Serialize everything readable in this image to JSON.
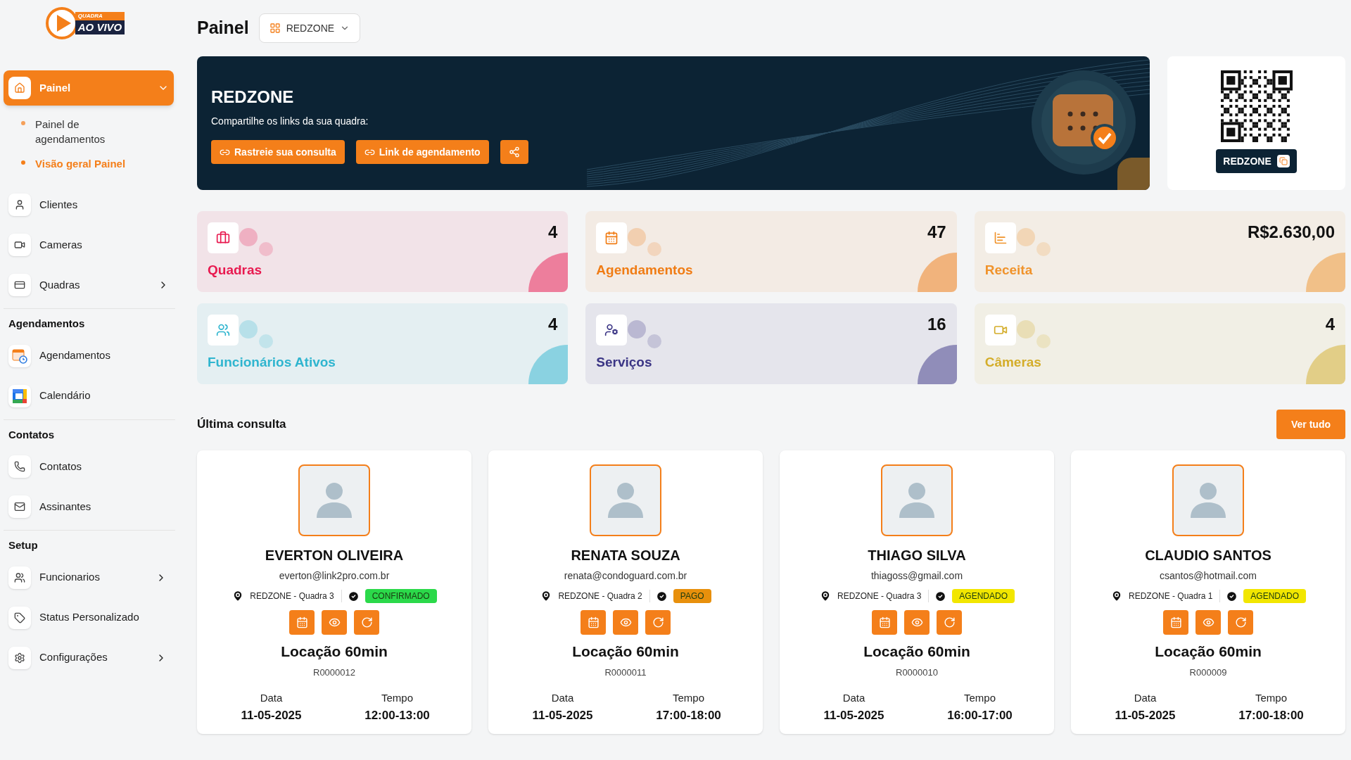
{
  "logo": {
    "top": "QUADRA",
    "bottom": "AO VIVO"
  },
  "sidebar": {
    "nav": [
      {
        "label": "Painel",
        "selected": true,
        "expanded": true,
        "children": [
          {
            "label": "Painel de agendamentos",
            "selected": false
          },
          {
            "label": "Visão geral Painel",
            "selected": true
          }
        ]
      },
      {
        "label": "Clientes",
        "selected": false
      },
      {
        "label": "Cameras",
        "selected": false
      },
      {
        "label": "Quadras",
        "selected": false,
        "expanded": false
      }
    ],
    "sections": [
      {
        "title": "Agendamentos",
        "items": [
          {
            "label": "Agendamentos",
            "selected": false
          },
          {
            "label": "Calendário",
            "selected": false
          }
        ]
      },
      {
        "title": "Contatos",
        "items": [
          {
            "label": "Contatos",
            "selected": false
          },
          {
            "label": "Assinantes",
            "selected": false
          }
        ]
      },
      {
        "title": "Setup",
        "items": [
          {
            "label": "Funcionarios",
            "selected": false,
            "expanded": false
          },
          {
            "label": "Status Personalizado",
            "selected": false
          },
          {
            "label": "Configurações",
            "selected": false,
            "expanded": false
          }
        ]
      }
    ]
  },
  "header": {
    "title": "Painel",
    "venue_select": "REDZONE"
  },
  "banner": {
    "title": "REDZONE",
    "subtitle": "Compartilhe os links da sua quadra:",
    "buttons": [
      "Rastreie sua consulta",
      "Link de agendamento"
    ]
  },
  "qr_card": {
    "label": "REDZONE"
  },
  "stats": [
    {
      "label": "Quadras",
      "value": "4",
      "color": "#e8194f"
    },
    {
      "label": "Agendamentos",
      "value": "47",
      "color": "#f07c14"
    },
    {
      "label": "Receita",
      "value": "R$2.630,00",
      "color": "#f0932b"
    },
    {
      "label": "Funcionários Ativos",
      "value": "4",
      "color": "#2fb5cf"
    },
    {
      "label": "Serviços",
      "value": "16",
      "color": "#3b3585"
    },
    {
      "label": "Câmeras",
      "value": "4",
      "color": "#d4ad2a"
    }
  ],
  "recent": {
    "title": "Última consulta",
    "view_all": "Ver tudo",
    "bookings": [
      {
        "name": "EVERTON OLIVEIRA",
        "email": "everton@link2pro.com.br",
        "court": "REDZONE - Quadra 3",
        "status": {
          "label": "CONFIRMADO",
          "color": "#2bd94a"
        },
        "service": "Locação 60min",
        "code": "R0000012",
        "date_label": "Data",
        "time_label": "Tempo",
        "date": "11-05-2025",
        "time": "12:00-13:00"
      },
      {
        "name": "RENATA SOUZA",
        "email": "renata@condoguard.com.br",
        "court": "REDZONE - Quadra 2",
        "status": {
          "label": "PAGO",
          "color": "#e8900c"
        },
        "service": "Locação 60min",
        "code": "R0000011",
        "date_label": "Data",
        "time_label": "Tempo",
        "date": "11-05-2025",
        "time": "17:00-18:00"
      },
      {
        "name": "THIAGO SILVA",
        "email": "thiagoss@gmail.com",
        "court": "REDZONE - Quadra 3",
        "status": {
          "label": "AGENDADO",
          "color": "#f2e600"
        },
        "service": "Locação 60min",
        "code": "R0000010",
        "date_label": "Data",
        "time_label": "Tempo",
        "date": "11-05-2025",
        "time": "16:00-17:00"
      },
      {
        "name": "CLAUDIO SANTOS",
        "email": "csantos@hotmail.com",
        "court": "REDZONE - Quadra 1",
        "status": {
          "label": "AGENDADO",
          "color": "#f2e600"
        },
        "service": "Locação 60min",
        "code": "R000009",
        "date_label": "Data",
        "time_label": "Tempo",
        "date": "11-05-2025",
        "time": "17:00-18:00"
      }
    ]
  }
}
